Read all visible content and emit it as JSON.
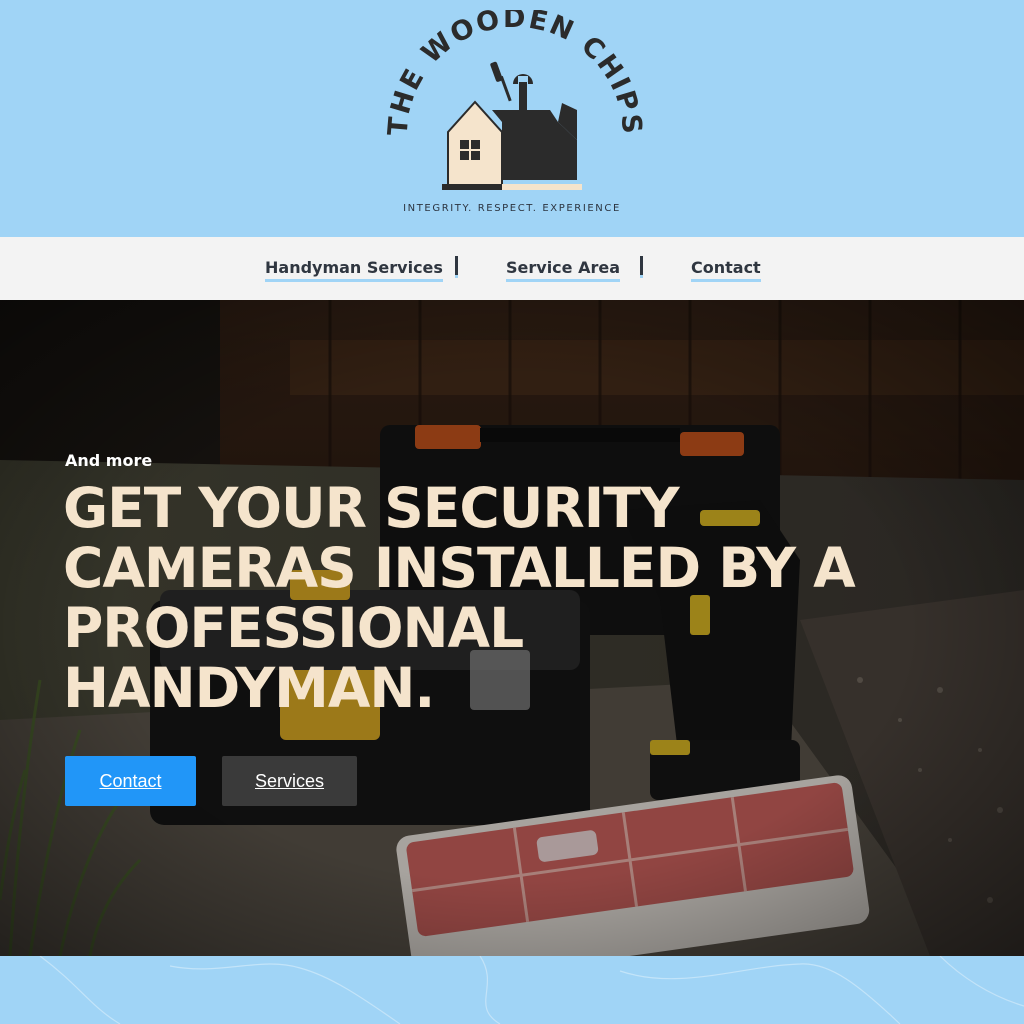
{
  "brand": {
    "name": "THE WOODEN CHIPS",
    "tagline": "INTEGRITY. RESPECT. EXPERIENCE",
    "logo_icon": "house-toolbox-wrench-icon"
  },
  "nav": {
    "items": [
      {
        "label": "Handyman Services"
      },
      {
        "label": "Service Area"
      },
      {
        "label": "Contact"
      }
    ]
  },
  "hero": {
    "eyebrow": "And more",
    "headline": "GET YOUR SECURITY CAMERAS INSTALLED BY A PROFESSIONAL HANDYMAN.",
    "buttons": {
      "contact": "Contact",
      "services": "Services"
    },
    "background": "photo of toolboxes, cordless drill and parts organizer on a stone step"
  },
  "colors": {
    "sky": "#a0d4f6",
    "nav_bg": "#f3f3f3",
    "headline": "#f5e4cc",
    "primary_button": "#2196f8",
    "secondary_button": "#3a3a3a"
  }
}
